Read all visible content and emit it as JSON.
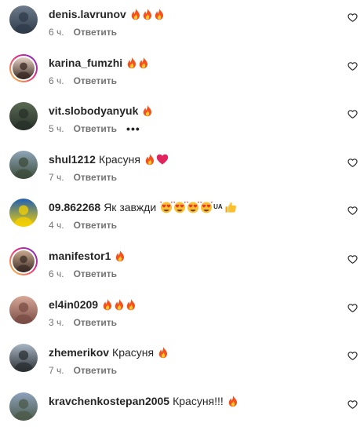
{
  "comments": [
    {
      "username": "denis.lavrunov",
      "text": "",
      "emojis": [
        "fire",
        "fire",
        "fire"
      ],
      "time": "6 ч.",
      "reply": "Ответить",
      "more": "",
      "avatar_colors": [
        "#6d7b8c",
        "#2f3b4a"
      ],
      "story": false
    },
    {
      "username": "karina_fumzhi",
      "text": "",
      "emojis": [
        "fire",
        "fire"
      ],
      "time": "6 ч.",
      "reply": "Ответить",
      "more": "",
      "avatar_colors": [
        "#e7d3c4",
        "#3a2a24"
      ],
      "story": true
    },
    {
      "username": "vit.slobodyanyuk",
      "text": "",
      "emojis": [
        "fire"
      ],
      "time": "5 ч.",
      "reply": "Ответить",
      "more": "•••",
      "avatar_colors": [
        "#5a6a52",
        "#27302a"
      ],
      "story": false
    },
    {
      "username": "shul1212",
      "text": "Красуня",
      "emojis": [
        "fire",
        "heart"
      ],
      "time": "7 ч.",
      "reply": "Ответить",
      "more": "",
      "avatar_colors": [
        "#8fa6b8",
        "#3c4b3a"
      ],
      "story": false
    },
    {
      "username": "09.862268",
      "text": "Як завжди",
      "emojis": [
        "smile-hearts",
        "smile-hearts",
        "smile-hearts",
        "smile-hearts",
        "UA",
        "thumbs"
      ],
      "time": "4 ч.",
      "reply": "Ответить",
      "more": "",
      "avatar_colors": [
        "#1e5fb4",
        "#f5d000"
      ],
      "story": false
    },
    {
      "username": "manifestor1",
      "text": "",
      "emojis": [
        "fire"
      ],
      "time": "6 ч.",
      "reply": "Ответить",
      "more": "",
      "avatar_colors": [
        "#c9a98d",
        "#3b2c26"
      ],
      "story": true
    },
    {
      "username": "el4in0209",
      "text": "",
      "emojis": [
        "fire",
        "fire",
        "fire"
      ],
      "time": "3 ч.",
      "reply": "Ответить",
      "more": "",
      "avatar_colors": [
        "#d7a898",
        "#7a4c44"
      ],
      "story": false
    },
    {
      "username": "zhemerikov",
      "text": "Красуня",
      "emojis": [
        "fire"
      ],
      "time": "7 ч.",
      "reply": "Ответить",
      "more": "",
      "avatar_colors": [
        "#a9b6c4",
        "#2a2f33"
      ],
      "story": false
    },
    {
      "username": "kravchenkostepan2005",
      "text": "Красуня!!!",
      "emojis": [
        "fire"
      ],
      "time": "",
      "reply": "",
      "more": "",
      "avatar_colors": [
        "#8ea3bd",
        "#4b5a4a"
      ],
      "story": false
    }
  ],
  "colors": {
    "text_primary": "#262626",
    "text_secondary": "#737373",
    "story_ring_start": "#f9ce34",
    "story_ring_mid": "#ee2a7b",
    "story_ring_end": "#6228d7"
  }
}
